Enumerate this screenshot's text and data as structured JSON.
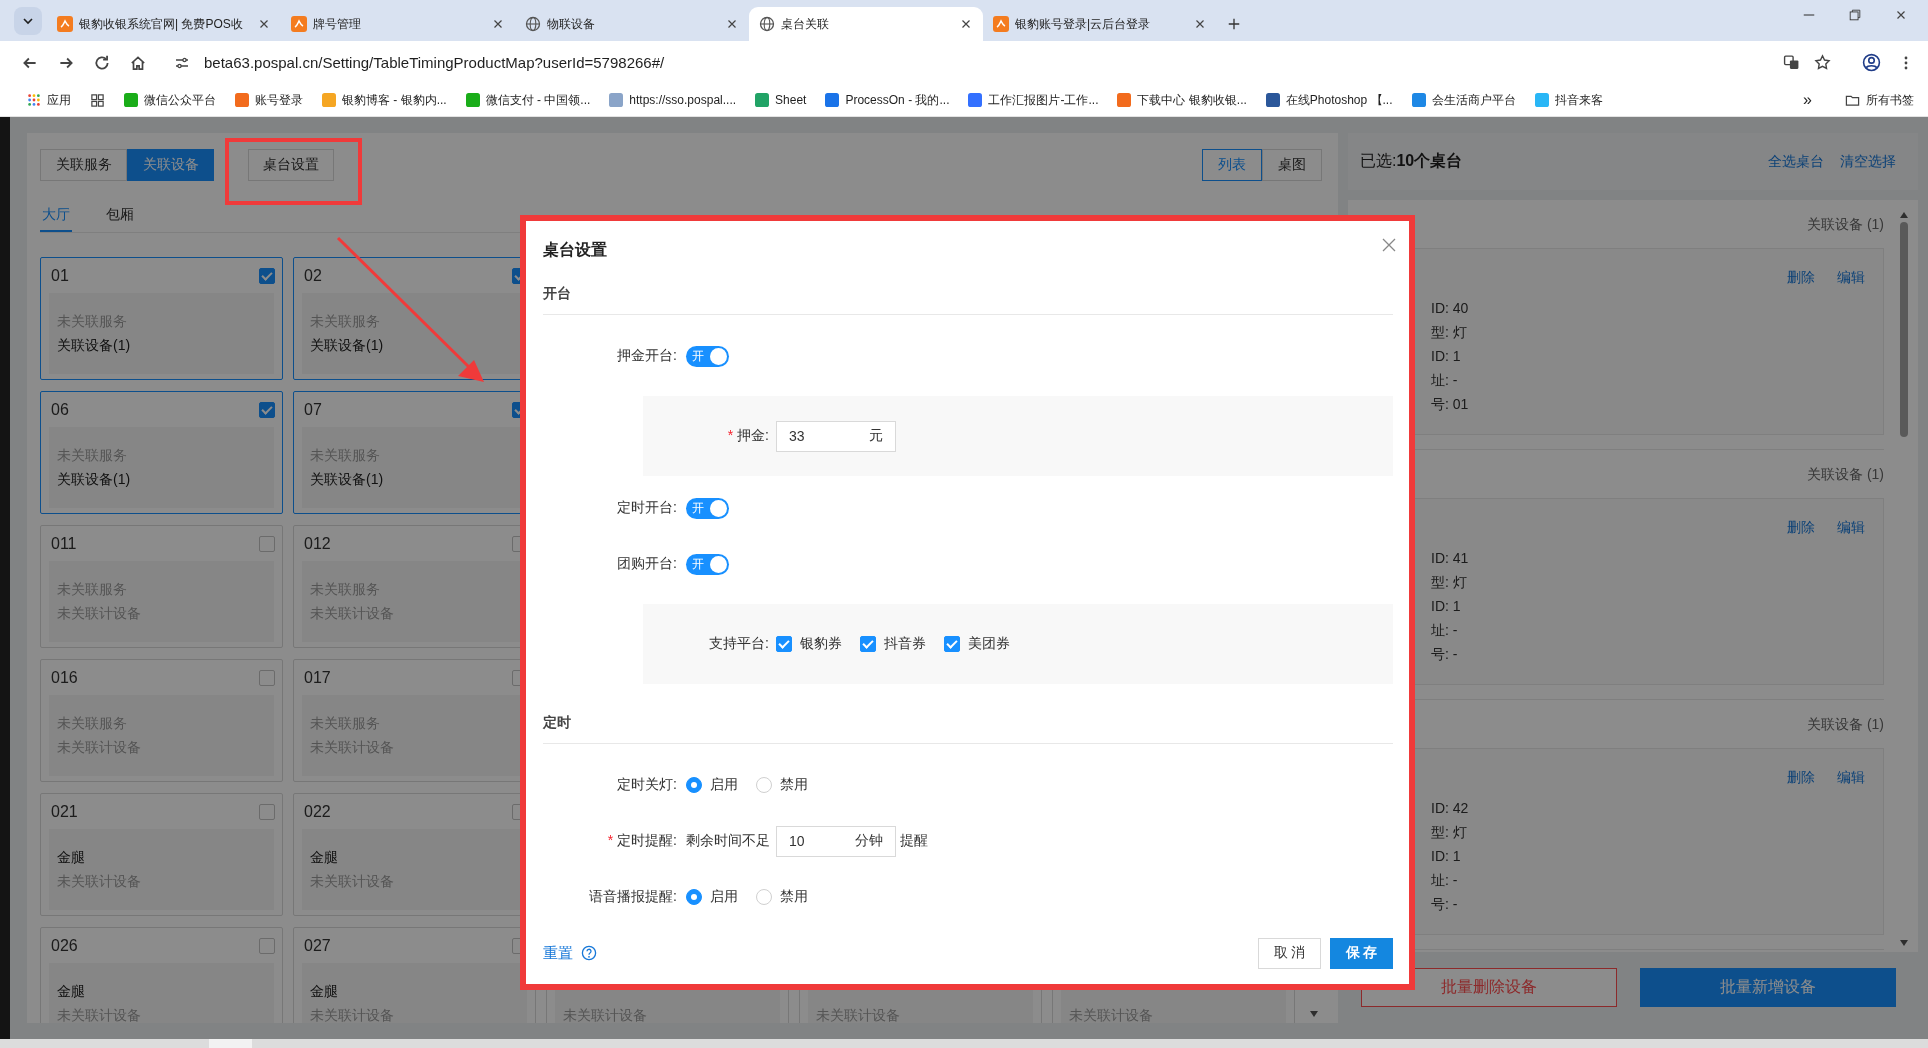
{
  "browser": {
    "tabs": [
      {
        "title": "银豹收银系统官网| 免费POS收",
        "selected": false,
        "kind": "brand"
      },
      {
        "title": "牌号管理",
        "selected": false,
        "kind": "brand"
      },
      {
        "title": "物联设备",
        "selected": false,
        "kind": "globe"
      },
      {
        "title": "桌台关联",
        "selected": true,
        "kind": "globe"
      },
      {
        "title": "银豹账号登录|云后台登录",
        "selected": false,
        "kind": "brand"
      }
    ],
    "url": "beta63.pospal.cn/Setting/TableTimingProductMap?userId=5798266#/",
    "apps_label": "应用",
    "bookmarks": [
      {
        "label": "微信公众平台",
        "color": "#1aad19"
      },
      {
        "label": "账号登录",
        "color": "#f26b1d"
      },
      {
        "label": "银豹博客 - 银豹内...",
        "color": "#f5a623"
      },
      {
        "label": "微信支付 - 中国领...",
        "color": "#1aad19"
      },
      {
        "label": "https://sso.pospal....",
        "color": "#8aa4c8"
      },
      {
        "label": "Sheet",
        "color": "#21a366"
      },
      {
        "label": "ProcessOn - 我的...",
        "color": "#1a73e8"
      },
      {
        "label": "工作汇报图片-工作...",
        "color": "#3370ff"
      },
      {
        "label": "下载中心 银豹收银...",
        "color": "#f26b1d"
      },
      {
        "label": "在线Photoshop 【...",
        "color": "#2b579a"
      },
      {
        "label": "会生活商户平台",
        "color": "#1e88e5"
      },
      {
        "label": "抖音来客",
        "color": "#29b6f6"
      }
    ],
    "overflow": "»",
    "all_bookmarks": "所有书签"
  },
  "toolbar": {
    "modes": [
      {
        "label": "关联服务",
        "selected": false
      },
      {
        "label": "关联设备",
        "selected": true
      }
    ],
    "settings_button": "桌台设置",
    "views": [
      {
        "label": "列表",
        "selected": true
      },
      {
        "label": "桌图",
        "selected": false
      }
    ]
  },
  "areas": [
    {
      "label": "大厅",
      "selected": true
    },
    {
      "label": "包厢",
      "selected": false
    }
  ],
  "table_rows": [
    {
      "cards": [
        {
          "number": "01",
          "checked": true,
          "service": {
            "text": "未关联服务",
            "linked": false
          },
          "device": {
            "text": "关联设备(1)",
            "linked": true
          }
        },
        {
          "number": "02",
          "checked": true,
          "service": {
            "text": "未关联服务",
            "linked": false
          },
          "device": {
            "text": "关联设备(1)",
            "linked": true
          }
        }
      ]
    },
    {
      "cards": [
        {
          "number": "06",
          "checked": true,
          "service": {
            "text": "未关联服务",
            "linked": false
          },
          "device": {
            "text": "关联设备(1)",
            "linked": true
          }
        },
        {
          "number": "07",
          "checked": true,
          "service": {
            "text": "未关联服务",
            "linked": false
          },
          "device": {
            "text": "关联设备(1)",
            "linked": true
          }
        }
      ]
    },
    {
      "cards": [
        {
          "number": "011",
          "checked": false,
          "service": {
            "text": "未关联服务",
            "linked": false
          },
          "device": {
            "text": "未关联计设备",
            "linked": false
          }
        },
        {
          "number": "012",
          "checked": false,
          "service": {
            "text": "未关联服务",
            "linked": false
          },
          "device": {
            "text": "未关联计设备",
            "linked": false
          }
        }
      ]
    },
    {
      "cards": [
        {
          "number": "016",
          "checked": false,
          "service": {
            "text": "未关联服务",
            "linked": false
          },
          "device": {
            "text": "未关联计设备",
            "linked": false
          }
        },
        {
          "number": "017",
          "checked": false,
          "service": {
            "text": "未关联服务",
            "linked": false
          },
          "device": {
            "text": "未关联计设备",
            "linked": false
          }
        }
      ]
    },
    {
      "cards": [
        {
          "number": "021",
          "checked": false,
          "service": {
            "text": "金腿",
            "linked": true
          },
          "device": {
            "text": "未关联计设备",
            "linked": false
          }
        },
        {
          "number": "022",
          "checked": false,
          "service": {
            "text": "金腿",
            "linked": true
          },
          "device": {
            "text": "未关联计设备",
            "linked": false
          }
        }
      ]
    },
    {
      "cards": [
        {
          "number": "026",
          "checked": false,
          "service": {
            "text": "金腿",
            "linked": true
          },
          "device": {
            "text": "未关联计设备",
            "linked": false
          }
        },
        {
          "number": "027",
          "checked": false,
          "service": {
            "text": "金腿",
            "linked": true
          },
          "device": {
            "text": "未关联计设备",
            "linked": false
          }
        },
        {
          "device": {
            "text": "未关联计设备",
            "linked": false
          }
        },
        {
          "device": {
            "text": "未关联计设备",
            "linked": false
          }
        },
        {
          "device": {
            "text": "未关联计设备",
            "linked": false
          }
        }
      ]
    }
  ],
  "selection": {
    "summary": "已选:**10个桌台**",
    "links": [
      "全选桌台",
      "清空选择"
    ]
  },
  "device_groups": [
    {
      "header": "关联设备 (1)",
      "actions": [
        "删除",
        "编辑"
      ],
      "lines": [
        "ID: 40",
        "型: 灯",
        "ID: 1",
        "址: -",
        "号: 01"
      ]
    },
    {
      "header": "关联设备 (1)",
      "actions": [
        "删除",
        "编辑"
      ],
      "lines": [
        "ID: 41",
        "型: 灯",
        "ID: 1",
        "址: -",
        "号: -"
      ]
    },
    {
      "header": "关联设备 (1)",
      "actions": [
        "删除",
        "编辑"
      ],
      "lines": [
        "ID: 42",
        "型: 灯",
        "ID: 1",
        "址: -",
        "号: -"
      ]
    }
  ],
  "bulk_buttons": [
    {
      "label": "批量删除设备",
      "kind": "danger"
    },
    {
      "label": "批量新增设备",
      "kind": "primary"
    }
  ],
  "dialog": {
    "title": "桌台设置",
    "sections": [
      {
        "title": "开台",
        "items": [
          {
            "kind": "switch",
            "label": "押金开台:",
            "on": true,
            "on_text": "开"
          },
          {
            "kind": "panel",
            "rows": [
              {
                "kind": "amount",
                "mark": "*",
                "label": "押金:",
                "value": "33",
                "unit": "元"
              }
            ]
          },
          {
            "kind": "switch",
            "label": "定时开台:",
            "on": true,
            "on_text": "开"
          },
          {
            "kind": "switch",
            "label": "团购开台:",
            "on": true,
            "on_text": "开"
          },
          {
            "kind": "panel",
            "rows": [
              {
                "kind": "checks",
                "label": "支持平台:",
                "options": [
                  {
                    "label": "银豹券",
                    "checked": true
                  },
                  {
                    "label": "抖音券",
                    "checked": true
                  },
                  {
                    "label": "美团券",
                    "checked": true
                  }
                ]
              }
            ]
          }
        ]
      },
      {
        "title": "定时",
        "items": [
          {
            "kind": "radio",
            "label": "定时关灯:",
            "options": [
              {
                "label": "启用",
                "selected": true
              },
              {
                "label": "禁用",
                "selected": false
              }
            ]
          },
          {
            "kind": "reminder",
            "mark": "*",
            "label": "定时提醒:",
            "prefix": "剩余时间不足",
            "value": "10",
            "unit": "分钟",
            "suffix": "提醒"
          },
          {
            "kind": "radio",
            "label": "语音播报提醒:",
            "options": [
              {
                "label": "启用",
                "selected": true
              },
              {
                "label": "禁用",
                "selected": false
              }
            ]
          }
        ]
      }
    ],
    "reset": "重置",
    "buttons": [
      {
        "label": "取 消",
        "kind": "default"
      },
      {
        "label": "保 存",
        "kind": "primary"
      }
    ]
  }
}
